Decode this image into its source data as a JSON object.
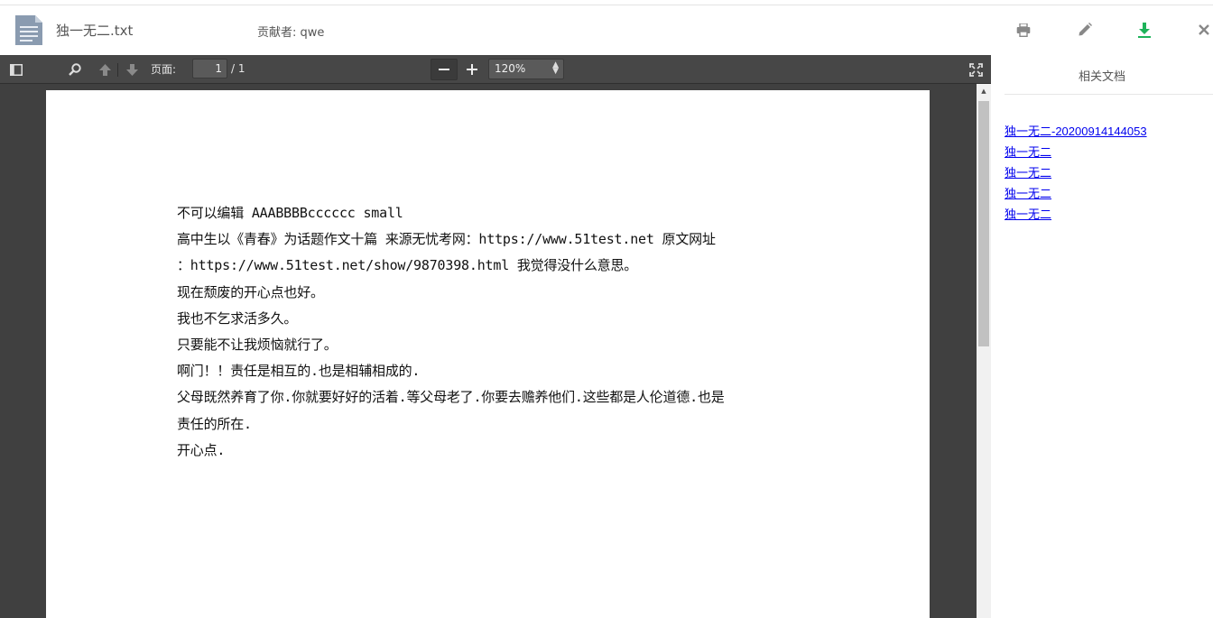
{
  "header": {
    "file_name": "独一无二.txt",
    "contributor": "贡献者: qwe",
    "icons": [
      "document-icon",
      "print-icon",
      "edit-icon",
      "download-icon",
      "close-icon"
    ],
    "accent_color": "#1eb35a"
  },
  "toolbar": {
    "page_label": "页面:",
    "page_current": "1",
    "page_total": "/ 1",
    "zoom_value": "120%"
  },
  "document": {
    "lines": [
      "不可以编辑  AAABBBBcccccc   small",
      "高中生以《青春》为话题作文十篇 来源无忧考网：https://www.51test.net 原文网址",
      "：https://www.51test.net/show/9870398.html 我觉得没什么意思。",
      "现在颓废的开心点也好。",
      "我也不乞求活多久。",
      "只要能不让我烦恼就行了。",
      "啊门！！责任是相互的.也是相辅相成的.",
      "父母既然养育了你.你就要好好的活着.等父母老了.你要去赡养他们.这些都是人伦道德.也是",
      "责任的所在.",
      "开心点."
    ]
  },
  "sidebar": {
    "title": "相关文档",
    "related": [
      "独一无二-20200914144053",
      "独一无二",
      "独一无二",
      "独一无二",
      "独一无二"
    ]
  }
}
